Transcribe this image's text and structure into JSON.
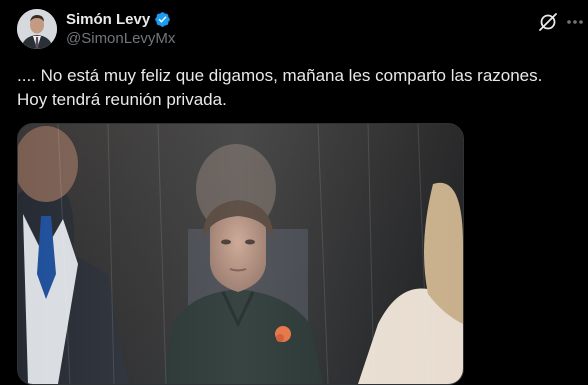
{
  "post": {
    "author_name": "Simón Levy",
    "author_handle": "@SimonLevyMx",
    "verified": true,
    "text_line1": ".... No está muy feliz que digamos, mañana les comparto las razones.",
    "text_line2": "Hoy tendrá reunión privada."
  },
  "icons": {
    "avatar": "author-avatar",
    "verified": "verified-badge-icon",
    "grok": "grok-icon",
    "more": "more-options-icon"
  },
  "colors": {
    "background": "#000000",
    "text": "#e7e9ea",
    "secondary_text": "#71767b",
    "verified_blue": "#1d9bf0"
  }
}
